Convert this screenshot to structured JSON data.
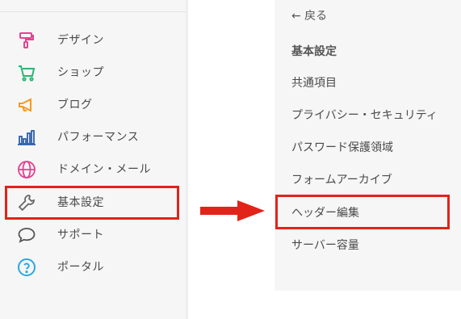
{
  "nav": {
    "items": [
      {
        "label": "デザイン",
        "icon": "paint-roller-icon",
        "color": "#e5428f"
      },
      {
        "label": "ショップ",
        "icon": "cart-icon",
        "color": "#2bb673"
      },
      {
        "label": "ブログ",
        "icon": "megaphone-icon",
        "color": "#f39a1e"
      },
      {
        "label": "パフォーマンス",
        "icon": "bar-chart-icon",
        "color": "#2e5fa8"
      },
      {
        "label": "ドメイン・メール",
        "icon": "globe-icon",
        "color": "#e5428f"
      },
      {
        "label": "基本設定",
        "icon": "wrench-icon",
        "color": "#666666"
      },
      {
        "label": "サポート",
        "icon": "chat-bubble-icon",
        "color": "#555555"
      },
      {
        "label": "ポータル",
        "icon": "help-circle-icon",
        "color": "#29a8e0"
      }
    ]
  },
  "submenu": {
    "back_label": "← 戻る",
    "heading": "基本設定",
    "items": [
      "共通項目",
      "プライバシー・セキュリティ",
      "パスワード保護領域",
      "フォームアーカイブ",
      "ヘッダー編集",
      "サーバー容量"
    ]
  },
  "annotation": {
    "highlight_color": "#e2231a"
  }
}
